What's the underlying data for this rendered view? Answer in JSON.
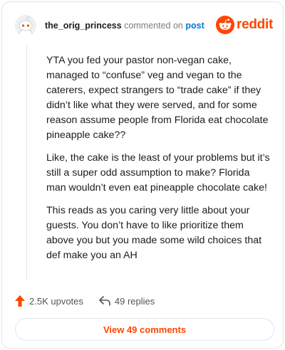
{
  "header": {
    "username": "the_orig_princess",
    "action_text": "commented on",
    "post_link": "post",
    "brand_name": "reddit"
  },
  "comment": {
    "paragraphs": [
      "YTA you fed your pastor non-vegan cake, managed to “confuse” veg and vegan to the caterers, expect strangers to “trade cake” if they didn’t like what they were served, and for some reason assume people from Florida eat chocolate pineapple cake??",
      "Like, the cake is the least of your problems but it’s still a super odd assumption to make? Florida man wouldn’t even eat pineapple chocolate cake!",
      "This reads as you caring very little about your guests. You don’t have to like prioritize them above you but you made some wild choices that def make you an AH"
    ]
  },
  "actions": {
    "upvotes": "2.5K upvotes",
    "replies": "49 replies"
  },
  "view_button": "View 49 comments",
  "colors": {
    "brand": "#ff4500",
    "link": "#0079d3"
  },
  "icons": {
    "avatar": "snoo-avatar",
    "brand": "reddit-logo-icon",
    "upvote": "upvote-arrow-icon",
    "reply": "reply-arrow-icon"
  }
}
